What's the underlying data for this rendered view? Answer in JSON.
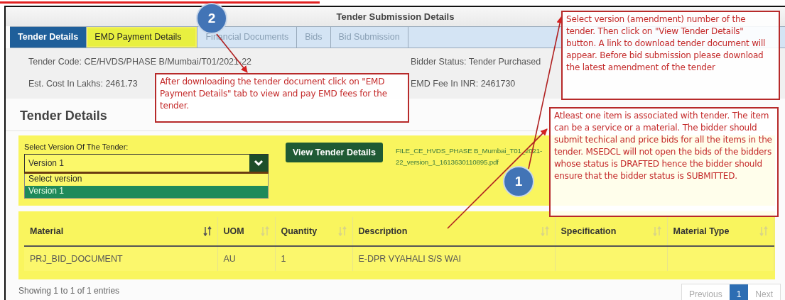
{
  "title": "Tender Submission Details",
  "tabs": [
    {
      "label": "Tender Details",
      "selected": true,
      "highlighted": false
    },
    {
      "label": "EMD Payment Details",
      "selected": false,
      "highlighted": true
    },
    {
      "label": "Financial Documents",
      "selected": false,
      "highlighted": false
    },
    {
      "label": "Bids",
      "selected": false,
      "highlighted": false
    },
    {
      "label": "Bid Submission",
      "selected": false,
      "highlighted": false
    }
  ],
  "info": [
    {
      "label": "Tender Code:",
      "value": "CE/HVDS/PHASE B/Mumbai/T01/2021-22"
    },
    {
      "label": "Bidder Status:",
      "value": "Tender Purchased"
    },
    {
      "label": "Est. Cost In Lakhs:",
      "value": "2461.73"
    },
    {
      "label": "EMD Fee In INR:",
      "value": "2461730"
    }
  ],
  "section_title": "Tender Details",
  "version_select": {
    "label": "Select Version Of The Tender:",
    "value": "Version 1",
    "expanded": true,
    "options": [
      {
        "label": "Select version",
        "selected": false
      },
      {
        "label": "Version 1",
        "selected": true
      }
    ]
  },
  "view_button": "View Tender Details",
  "file_link": "FILE_CE_HVDS_PHASE B_Mumbai_T01_2021-22_version_1_1613630110895.pdf",
  "table": {
    "columns": [
      {
        "label": "Material",
        "sorted": true
      },
      {
        "label": "UOM",
        "sorted": false
      },
      {
        "label": "Quantity",
        "sorted": false
      },
      {
        "label": "Description",
        "sorted": false
      },
      {
        "label": "Specification",
        "sorted": false
      },
      {
        "label": "Material Type",
        "sorted": false
      }
    ],
    "rows": [
      {
        "cells": [
          "PRJ_BID_DOCUMENT",
          "AU",
          "1",
          "E-DPR VYAHALI S/S WAI"
        ]
      }
    ]
  },
  "entries_info": "Showing 1 to 1 of 1 entries",
  "pagination": {
    "previous": "Previous",
    "pages": [
      {
        "label": "1",
        "selected": true
      }
    ],
    "next": "Next"
  },
  "callouts": [
    "Select version (amendment) number of the tender. Then click on \"View Tender Details\" button. A link to download tender document will appear. Before bid submission please download the latest amendment of the tender",
    "After downloading the tender document click on \"EMD Payment Details\" tab to view and pay EMD fees for the tender.",
    "Atleast one item is associated with tender. The item can be a service or a material. The bidder should submit techical and price bids for all the items in the tender. MSEDCL will not open the bids of the bidders whose status is DRAFTED hence the bidder should ensure that the bidder status is SUBMITTED."
  ],
  "markers": [
    "1",
    "2"
  ]
}
